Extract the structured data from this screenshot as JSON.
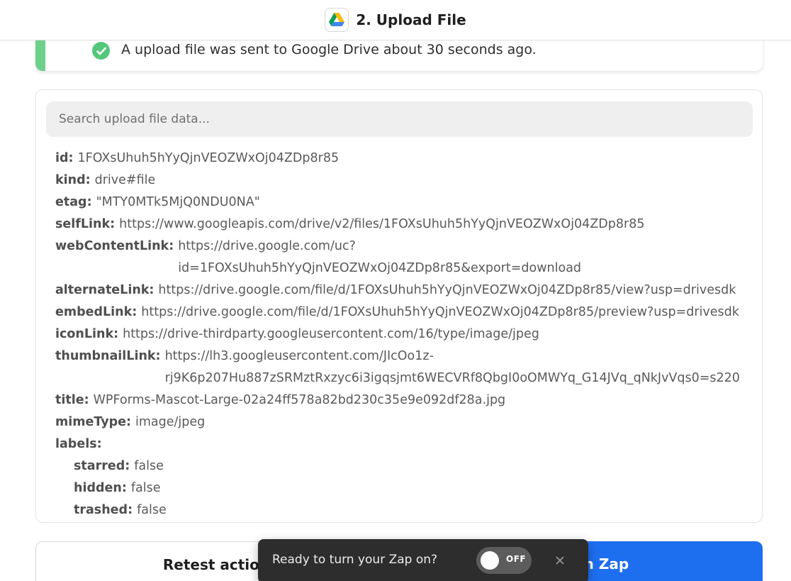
{
  "header": {
    "title": "2. Upload File",
    "app_icon": "google-drive-icon"
  },
  "banner": {
    "message": "A upload file was sent to Google Drive about 30 seconds ago.",
    "icon": "check-circle-icon",
    "accent_color": "#6fd08c"
  },
  "search": {
    "placeholder": "Search upload file data..."
  },
  "fields": {
    "id": {
      "key": "id:",
      "value": "1FOXsUhuh5hYyQjnVEOZWxOj04ZDp8r85"
    },
    "kind": {
      "key": "kind:",
      "value": "drive#file"
    },
    "etag": {
      "key": "etag:",
      "value": "\"MTY0MTk5MjQ0NDU0NA\""
    },
    "selfLink": {
      "key": "selfLink:",
      "value": "https://www.googleapis.com/drive/v2/files/1FOXsUhuh5hYyQjnVEOZWxOj04ZDp8r85"
    },
    "webContentLink": {
      "key": "webContentLink:",
      "line1": "https://drive.google.com/uc?",
      "line2": "id=1FOXsUhuh5hYyQjnVEOZWxOj04ZDp8r85&export=download"
    },
    "alternateLink": {
      "key": "alternateLink:",
      "value": "https://drive.google.com/file/d/1FOXsUhuh5hYyQjnVEOZWxOj04ZDp8r85/view?usp=drivesdk"
    },
    "embedLink": {
      "key": "embedLink:",
      "value": "https://drive.google.com/file/d/1FOXsUhuh5hYyQjnVEOZWxOj04ZDp8r85/preview?usp=drivesdk"
    },
    "iconLink": {
      "key": "iconLink:",
      "value": "https://drive-thirdparty.googleusercontent.com/16/type/image/jpeg"
    },
    "thumbnailLink": {
      "key": "thumbnailLink:",
      "line1": "https://lh3.googleusercontent.com/JIcOo1z-",
      "line2": "rj9K6p207Hu887zSRMztRxzyc6i3igqsjmt6WECVRf8QbgI0oOMWYq_G14JVq_qNkJvVqs0=s220"
    },
    "title": {
      "key": "title:",
      "value": "WPForms-Mascot-Large-02a24ff578a82bd230c35e9e092df28a.jpg"
    },
    "mimeType": {
      "key": "mimeType:",
      "value": "image/jpeg"
    },
    "labels": {
      "key": "labels:"
    },
    "starred": {
      "key": "starred:",
      "value": "false"
    },
    "hidden": {
      "key": "hidden:",
      "value": "false"
    },
    "trashed": {
      "key": "trashed:",
      "value": "false"
    }
  },
  "buttons": {
    "retest": "Retest action",
    "publish": "Publish Zap",
    "publish_color": "#1e6ff0"
  },
  "toast": {
    "message": "Ready to turn your Zap on?",
    "toggle_label": "OFF",
    "close_icon": "close-icon"
  }
}
